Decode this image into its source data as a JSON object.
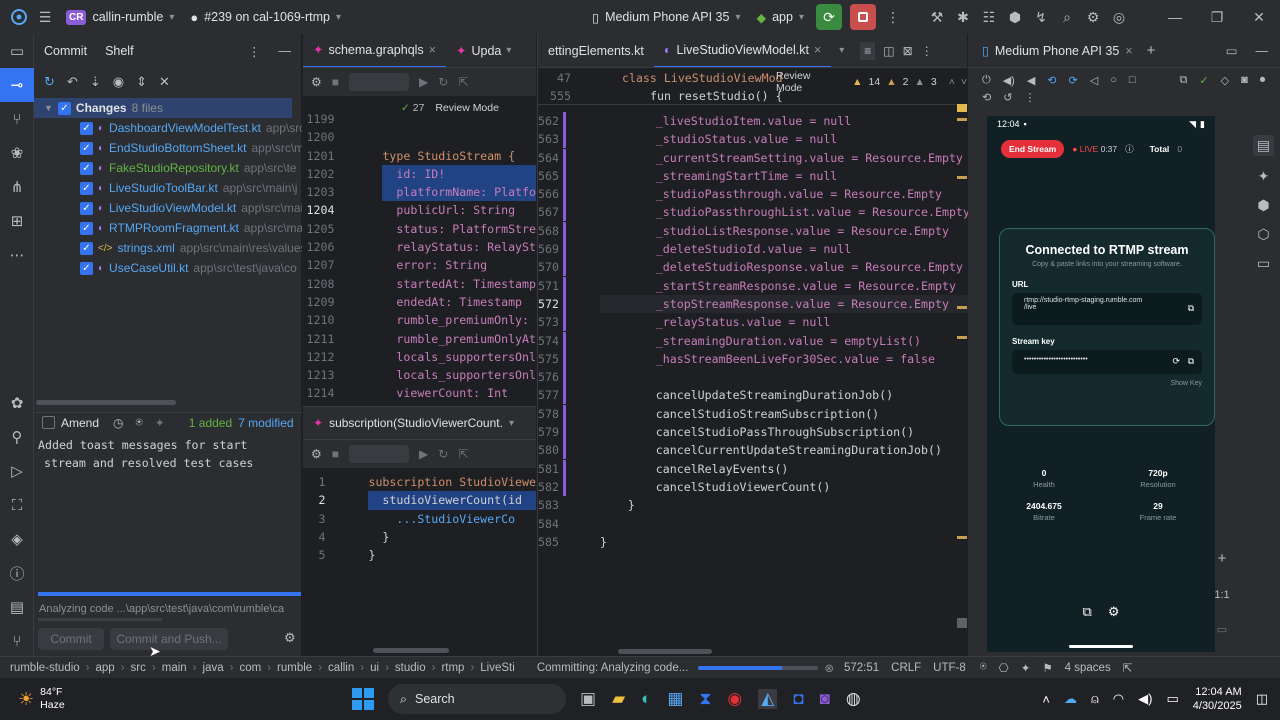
{
  "titlebar": {
    "project_badge": "CR",
    "project": "callin-rumble",
    "pr": "#239 on cal-1069-rtmp",
    "device": "Medium Phone API 35",
    "run_config": "app"
  },
  "commit_panel": {
    "tabs": [
      "Commit",
      "Shelf"
    ],
    "changes_label": "Changes",
    "changes_count": "8 files",
    "files": [
      {
        "name": "DashboardViewModelTest.kt",
        "path": "app\\src\\"
      },
      {
        "name": "EndStudioBottomSheet.kt",
        "path": "app\\src\\m"
      },
      {
        "name": "FakeStudioRepository.kt",
        "path": "app\\src\\te"
      },
      {
        "name": "LiveStudioToolBar.kt",
        "path": "app\\src\\main\\j"
      },
      {
        "name": "LiveStudioViewModel.kt",
        "path": "app\\src\\mai"
      },
      {
        "name": "RTMPRoomFragment.kt",
        "path": "app\\src\\mai"
      },
      {
        "name": "strings.xml",
        "path": "app\\src\\main\\res\\values"
      },
      {
        "name": "UseCaseUtil.kt",
        "path": "app\\src\\test\\java\\co"
      }
    ],
    "amend": "Amend",
    "added": "1 added",
    "modified": "7 modified",
    "message_line1": "Added toast messages for start",
    "message_line2": "stream and resolved test cases",
    "analyzing": "Analyzing code ...\\app\\src\\test\\java\\com\\rumble\\ca",
    "commit_btn": "Commit",
    "commit_push_btn": "Commit and Push..."
  },
  "graphql_editor": {
    "tabs": [
      "schema.graphqls",
      "Upda"
    ],
    "hint_count": "27",
    "review_mode": "Review Mode",
    "line_numbers": [
      "1199",
      "1200",
      "1201",
      "1202",
      "1203",
      "1204",
      "1205",
      "1206",
      "1207",
      "1208",
      "1209",
      "1210",
      "1211",
      "1212",
      "1213",
      "1214"
    ],
    "lines": [
      "  ",
      "",
      "type StudioStream {",
      "  id: ID!",
      "  platformName: Platfo",
      "  publicUrl: String",
      "  status: PlatformStre",
      "  relayStatus: RelaySt",
      "  error: String",
      "  startedAt: Timestamp",
      "  endedAt: Timestamp",
      "  rumble_premiumOnly: ",
      "  rumble_premiumOnlyAt",
      "  locals_supportersOnl",
      "  locals_supportersOnl",
      "  viewerCount: Int"
    ]
  },
  "subscription_editor": {
    "tab": "subscription(StudioViewerCount.",
    "line_numbers": [
      "1",
      "2",
      "3",
      "4",
      "5"
    ],
    "lines": [
      "subscription StudioViewe",
      "  studioViewerCount(id",
      "    ...StudioViewerCo",
      "  }",
      "}"
    ]
  },
  "kotlin_editor": {
    "tabs": [
      "ettingElements.kt",
      "LiveStudioViewModel.kt"
    ],
    "breadcrumb_class": "class LiveStudioViewMod",
    "breadcrumb_fun": "fun resetStudio() {",
    "review_mode": "Review Mode",
    "warnings": "14",
    "weak_warnings": "2",
    "hints": "3",
    "line_numbers": [
      "47",
      "555",
      "562",
      "563",
      "564",
      "565",
      "566",
      "567",
      "568",
      "569",
      "570",
      "571",
      "572",
      "573",
      "574",
      "575",
      "576",
      "577",
      "578",
      "579",
      "580",
      "581",
      "582",
      "583",
      "584",
      "585"
    ],
    "lines": [
      "",
      "",
      "        _liveStudioItem.value = null",
      "        _studioStatus.value = null",
      "        _currentStreamSetting.value = Resource.Empty",
      "        _streamingStartTime = null",
      "        _studioPassthrough.value = Resource.Empty",
      "        _studioPassthroughList.value = Resource.Empty",
      "        _studioListResponse.value = Resource.Empty",
      "        _deleteStudioId.value = null",
      "        _deleteStudioResponse.value = Resource.Empty",
      "        _startStreamResponse.value = Resource.Empty",
      "        _stopStreamResponse.value = Resource.Empty",
      "        _relayStatus.value = null",
      "        _streamingDuration.value = emptyList()",
      "        _hasStreamBeenLiveFor30Sec.value = false",
      "",
      "        cancelUpdateStreamingDurationJob()",
      "        cancelStudioStreamSubscription()",
      "        cancelStudioPassThroughSubscription()",
      "        cancelCurrentUpdateStreamingDurationJob()",
      "        cancelRelayEvents()",
      "        cancelStudioViewerCount()",
      "    }",
      "",
      "}"
    ]
  },
  "emulator": {
    "tab": "Medium Phone API 35",
    "time": "12:04",
    "end_stream": "End Stream",
    "live": "LIVE",
    "live_time": "0:37",
    "total_label": "Total",
    "total_value": "0",
    "connected_title": "Connected to RTMP stream",
    "connected_sub": "Copy & paste links into your streaming software.",
    "url_label": "URL",
    "url_value_1": "rtmp://studio-rtmp-staging.rumble.com",
    "url_value_2": "/live",
    "stream_key_label": "Stream key",
    "stream_key_value": "••••••••••••••••••••••••••",
    "show_key": "Show Key",
    "stats": [
      {
        "value": "0",
        "label": "Health"
      },
      {
        "value": "720p",
        "label": "Resolution"
      },
      {
        "value": "2404.675",
        "label": "Bitrate"
      },
      {
        "value": "29",
        "label": "Frame rate"
      }
    ],
    "zoom": "1:1"
  },
  "statusbar": {
    "path": [
      "rumble-studio",
      "app",
      "src",
      "main",
      "java",
      "com",
      "rumble",
      "callin",
      "ui",
      "studio",
      "rtmp",
      "LiveSti"
    ],
    "progress_text": "Committing: Analyzing code...",
    "progress": 0.7,
    "position": "572:51",
    "line_ending": "CRLF",
    "encoding": "UTF-8",
    "indent": "4 spaces"
  },
  "taskbar": {
    "temp": "84°F",
    "weather": "Haze",
    "search": "Search",
    "time": "12:04 AM",
    "date": "4/30/2025"
  },
  "colors": {
    "accent": "#3574f0",
    "end_stream": "#e5303a",
    "live_red": "#ff4b4b",
    "keyword": "#cf8e6d",
    "field": "#c77dbb"
  }
}
